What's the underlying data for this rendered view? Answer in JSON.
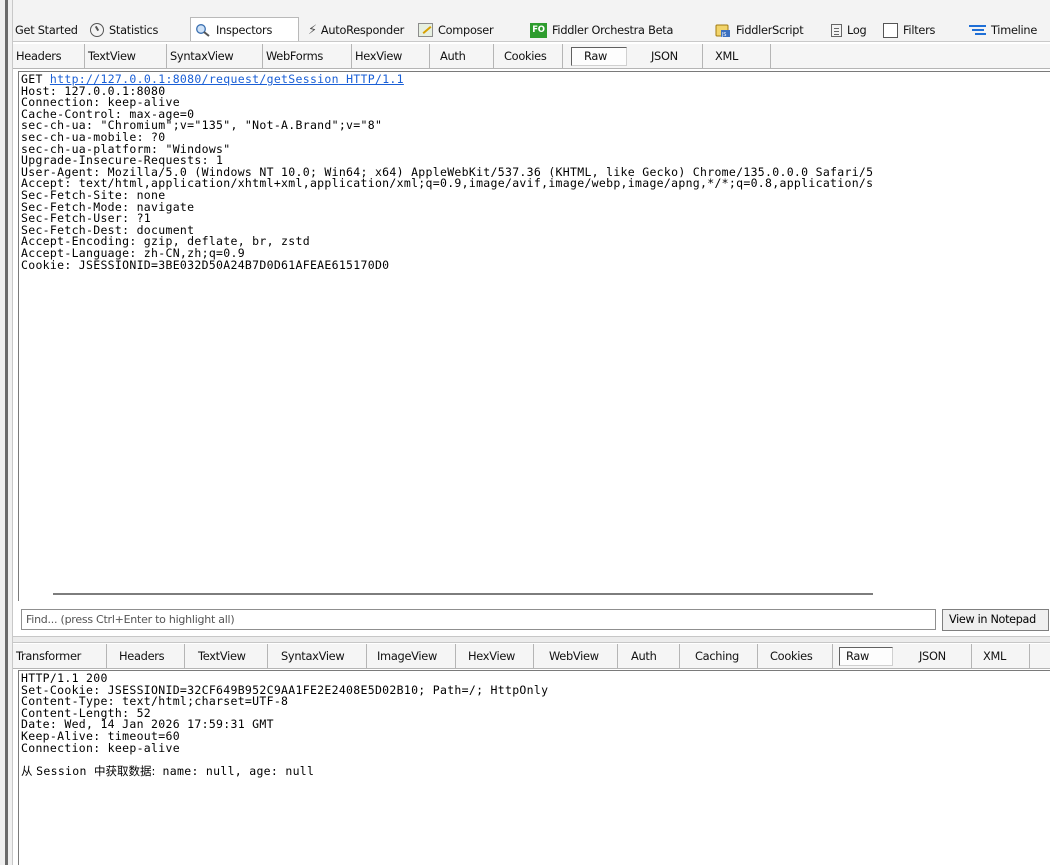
{
  "top_tabs": [
    {
      "label": "Get Started",
      "icon": "none"
    },
    {
      "label": "Statistics",
      "icon": "stopwatch-icon"
    },
    {
      "label": "Inspectors",
      "icon": "inspector-icon",
      "active": true
    },
    {
      "label": "AutoResponder",
      "icon": "lightning-icon"
    },
    {
      "label": "Composer",
      "icon": "composer-pen-icon"
    },
    {
      "label": "Fiddler Orchestra Beta",
      "icon": "fo-badge-icon",
      "badge": "FO"
    },
    {
      "label": "FiddlerScript",
      "icon": "script-js-icon"
    },
    {
      "label": "Log",
      "icon": "log-icon"
    },
    {
      "label": "Filters",
      "icon": "checkbox-icon"
    },
    {
      "label": "Timeline",
      "icon": "timeline-icon"
    }
  ],
  "request_tabs": [
    "Headers",
    "TextView",
    "SyntaxView",
    "WebForms",
    "HexView",
    "Auth",
    "Cookies",
    "Raw",
    "JSON",
    "XML"
  ],
  "request_active_tab": "Raw",
  "request": {
    "method": "GET ",
    "url": "http://127.0.0.1:8080/request/getSession",
    "protocol": " HTTP/1.1",
    "headers": [
      "Host: 127.0.0.1:8080",
      "Connection: keep-alive",
      "Cache-Control: max-age=0",
      "sec-ch-ua: \"Chromium\";v=\"135\", \"Not-A.Brand\";v=\"8\"",
      "sec-ch-ua-mobile: ?0",
      "sec-ch-ua-platform: \"Windows\"",
      "Upgrade-Insecure-Requests: 1",
      "User-Agent: Mozilla/5.0 (Windows NT 10.0; Win64; x64) AppleWebKit/537.36 (KHTML, like Gecko) Chrome/135.0.0.0 Safari/5",
      "Accept: text/html,application/xhtml+xml,application/xml;q=0.9,image/avif,image/webp,image/apng,*/*;q=0.8,application/s",
      "Sec-Fetch-Site: none",
      "Sec-Fetch-Mode: navigate",
      "Sec-Fetch-User: ?1",
      "Sec-Fetch-Dest: document",
      "Accept-Encoding: gzip, deflate, br, zstd",
      "Accept-Language: zh-CN,zh;q=0.9",
      "Cookie: JSESSIONID=3BE032D50A24B7D0D61AFEAE615170D0"
    ]
  },
  "find": {
    "placeholder": "Find... (press Ctrl+Enter to highlight all)",
    "notepad_label": "View in Notepad"
  },
  "response_tabs": [
    "Transformer",
    "Headers",
    "TextView",
    "SyntaxView",
    "ImageView",
    "HexView",
    "WebView",
    "Auth",
    "Caching",
    "Cookies",
    "Raw",
    "JSON",
    "XML"
  ],
  "response_active_tab": "Raw",
  "response": {
    "lines": [
      "HTTP/1.1 200",
      "Set-Cookie: JSESSIONID=32CF649B952C9AA1FE2E2408E5D02B10; Path=/; HttpOnly",
      "Content-Type: text/html;charset=UTF-8",
      "Content-Length: 52",
      "Date: Wed, 14 Jan 2026 17:59:31 GMT",
      "Keep-Alive: timeout=60",
      "Connection: keep-alive",
      ""
    ],
    "body_cjk": "从 ",
    "body_text": "Session ",
    "body_cjk2": "中获取数据:",
    "body_rest": " name: null, age: null"
  }
}
